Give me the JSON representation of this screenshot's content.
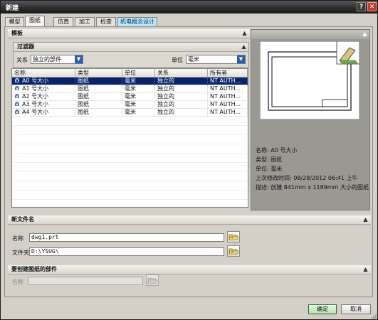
{
  "window": {
    "title": "新建"
  },
  "title_buttons": {
    "help": "?",
    "close": "✕"
  },
  "tabs": [
    {
      "label": "模型",
      "active": false
    },
    {
      "label": "图纸",
      "active": true
    },
    {
      "label": "仿真",
      "active": false
    },
    {
      "label": "加工",
      "active": false
    },
    {
      "label": "检查",
      "active": false
    },
    {
      "label": "机电概念设计",
      "active": false
    }
  ],
  "template_section": {
    "title": "模板",
    "filter": {
      "title": "过滤器",
      "relation_label": "关系",
      "relation_value": "独立的部件",
      "unit_label": "单位",
      "unit_value": "毫米"
    },
    "columns": [
      "名称",
      "类型",
      "单位",
      "关系",
      "所有者"
    ],
    "rows": [
      {
        "name": "A0 号大小",
        "type": "图纸",
        "unit": "毫米",
        "relation": "独立的",
        "owner": "NT AUTH...",
        "selected": true
      },
      {
        "name": "A1 号大小",
        "type": "图纸",
        "unit": "毫米",
        "relation": "独立的",
        "owner": "NT AUTH...",
        "selected": false
      },
      {
        "name": "A2 号大小",
        "type": "图纸",
        "unit": "毫米",
        "relation": "独立的",
        "owner": "NT AUTH...",
        "selected": false
      },
      {
        "name": "A3 号大小",
        "type": "图纸",
        "unit": "毫米",
        "relation": "独立的",
        "owner": "NT AUTH...",
        "selected": false
      },
      {
        "name": "A4 号大小",
        "type": "图纸",
        "unit": "毫米",
        "relation": "独立的",
        "owner": "NT AUTH...",
        "selected": false
      }
    ]
  },
  "preview": {
    "name_label": "名称:",
    "name_value": "A0 号大小",
    "type_label": "类型:",
    "type_value": "图纸",
    "unit_label": "单位:",
    "unit_value": "毫米",
    "modified_label": "上次修改时间:",
    "modified_value": "08/28/2012 06:41 上午",
    "desc_label": "描述:",
    "desc_value": "创建 841mm x 1189mm 大小的图纸"
  },
  "new_filename": {
    "title": "新文件名",
    "name_label": "名称",
    "name_value": "dwg1.prt",
    "folder_label": "文件夹",
    "folder_value": "D:\\YSUG\\"
  },
  "create_part": {
    "title": "要创建图纸的部件",
    "name_label": "名称",
    "name_value": ""
  },
  "buttons": {
    "ok": "确定",
    "cancel": "取消"
  },
  "colors": {
    "selection": "#0a246a",
    "highlight_tab": "#bfe6f5",
    "ok_button": "#b6e0b0",
    "close_button": "#c63b2c"
  },
  "icons": {
    "row_icon": "drawing-template-icon",
    "folder": "folder-open-icon"
  }
}
